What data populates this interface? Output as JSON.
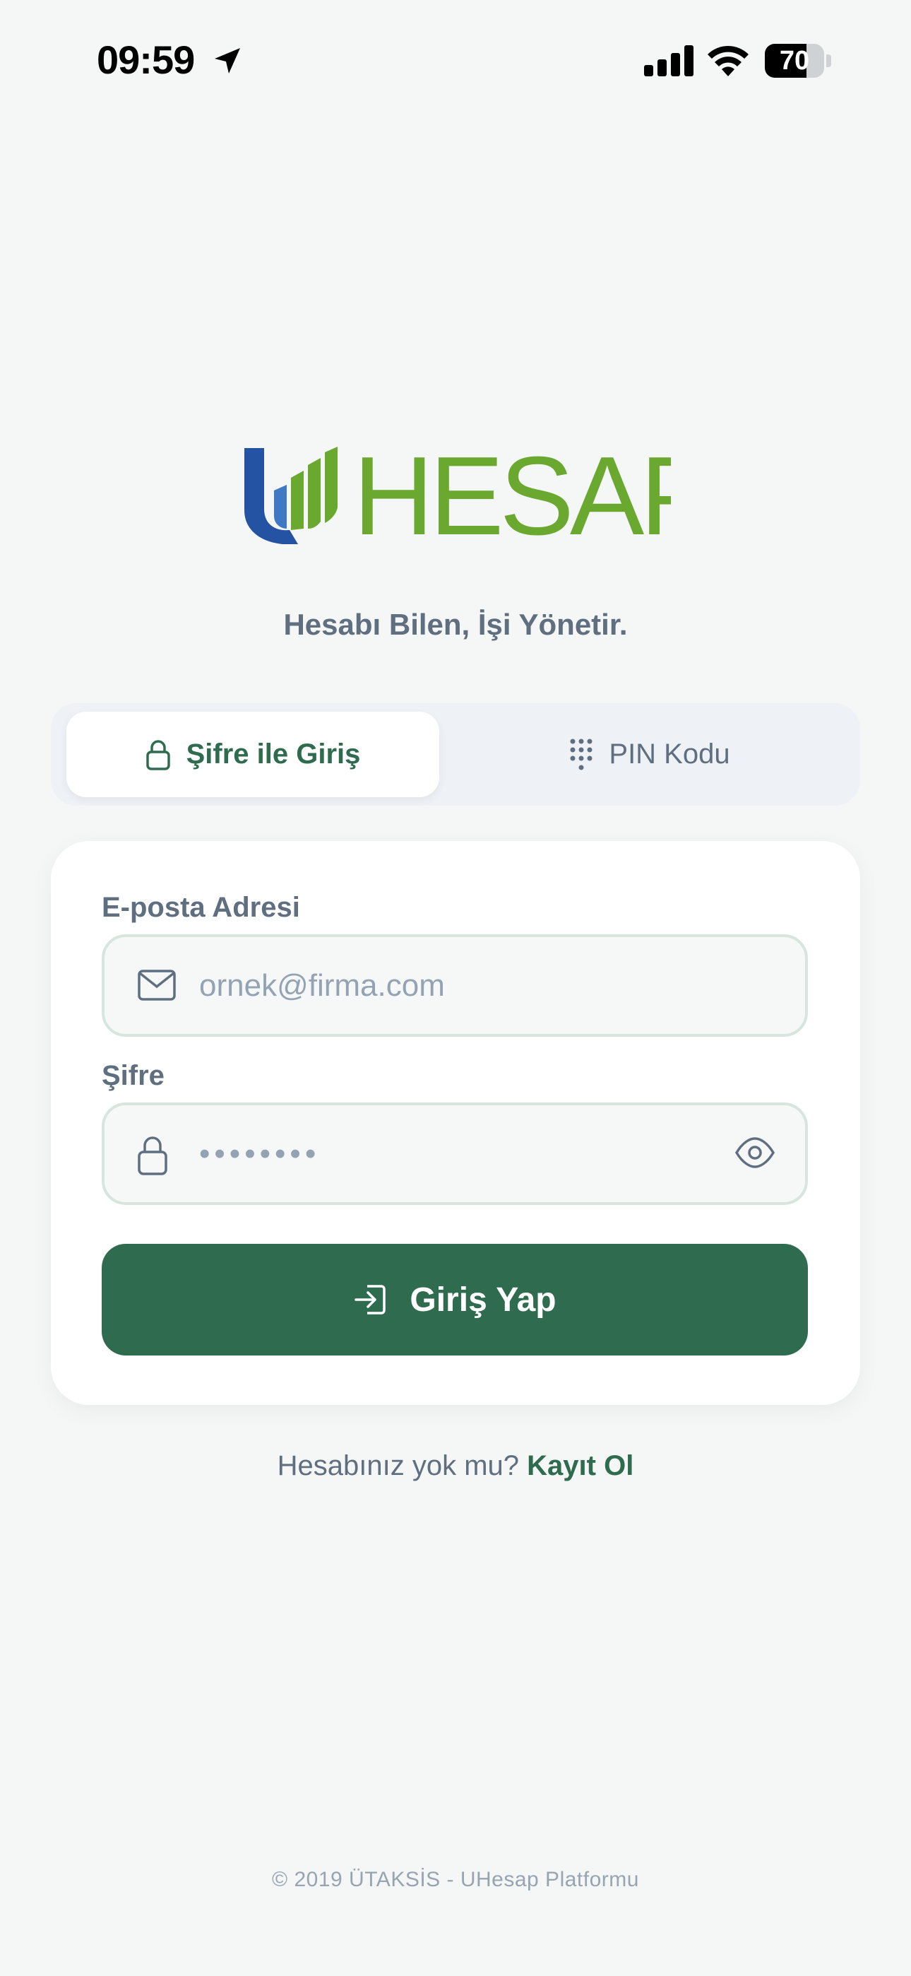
{
  "status_bar": {
    "time": "09:59",
    "battery_level": 70,
    "battery_text": "70",
    "icons": [
      "location-arrow-icon",
      "cellular-signal-icon",
      "wifi-icon",
      "battery-icon"
    ]
  },
  "brand": {
    "logo_text": "HESAP",
    "tagline": "Hesabı Bilen, İşi Yönetir.",
    "colors": {
      "green": "#6aa82f",
      "blue": "#2553a3",
      "accent": "#2e6b4f"
    }
  },
  "tabs": [
    {
      "label": "Şifre ile Giriş",
      "icon": "lock-icon",
      "active": true
    },
    {
      "label": "PIN Kodu",
      "icon": "keypad-icon",
      "active": false
    }
  ],
  "form": {
    "email": {
      "label": "E-posta Adresi",
      "placeholder": "ornek@firma.com",
      "value": "",
      "icon": "mail-icon"
    },
    "password": {
      "label": "Şifre",
      "placeholder": "••••••••",
      "value": "",
      "icon": "lock-icon",
      "toggle_icon": "eye-icon"
    },
    "submit_label": "Giriş Yap",
    "submit_icon": "login-arrow-icon"
  },
  "signup": {
    "prompt": "Hesabınız yok mu?",
    "link": "Kayıt Ol"
  },
  "footer": {
    "text": "© 2019 ÜTAKSİS - UHesap Platformu"
  }
}
